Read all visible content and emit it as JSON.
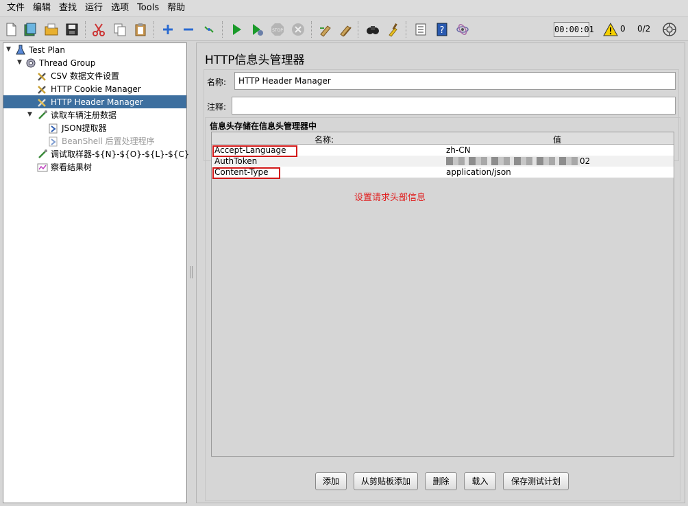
{
  "menu": [
    "文件",
    "编辑",
    "查找",
    "运行",
    "选项",
    "Tools",
    "帮助"
  ],
  "toolbar": {
    "timer": "00:00:01",
    "warning_count": "0",
    "thread_count": "0/2"
  },
  "tree": [
    {
      "label": "Test Plan",
      "icon": "test-plan-icon"
    },
    {
      "label": "Thread Group",
      "icon": "thread-group-icon"
    },
    {
      "label": "CSV 数据文件设置",
      "icon": "config-element-icon"
    },
    {
      "label": "HTTP Cookie Manager",
      "icon": "config-element-icon"
    },
    {
      "label": "HTTP Header Manager",
      "icon": "config-element-icon",
      "selected": true
    },
    {
      "label": "读取车辆注册数据",
      "icon": "sampler-icon"
    },
    {
      "label": "JSON提取器",
      "icon": "post-processor-icon"
    },
    {
      "label": "BeanShell 后置处理程序",
      "icon": "post-processor-icon",
      "disabled": true
    },
    {
      "label": "调试取样器-${N}-${O}-${L}-${C}",
      "icon": "sampler-icon"
    },
    {
      "label": "察看结果树",
      "icon": "listener-icon"
    }
  ],
  "panel": {
    "title": "HTTP信息头管理器",
    "name_label": "名称:",
    "name_value": "HTTP Header Manager",
    "comment_label": "注释:",
    "comment_value": "",
    "table_title": "信息头存储在信息头管理器中",
    "col_name": "名称:",
    "col_value": "值",
    "headers": [
      {
        "name": "Accept-Language",
        "value": "zh-CN",
        "highlighted": true
      },
      {
        "name": "AuthToken",
        "value": "02",
        "redacted": true,
        "highlighted": false
      },
      {
        "name": "Content-Type",
        "value": "application/json",
        "highlighted": true
      }
    ],
    "annotation": "设置请求头部信息",
    "buttons": {
      "add": "添加",
      "add_clipboard": "从剪贴板添加",
      "delete": "删除",
      "load": "载入",
      "save": "保存测试计划"
    }
  },
  "colors": {
    "selection": "#3d6f9f",
    "highlight_box": "#d21919",
    "annotation": "#e02020"
  }
}
